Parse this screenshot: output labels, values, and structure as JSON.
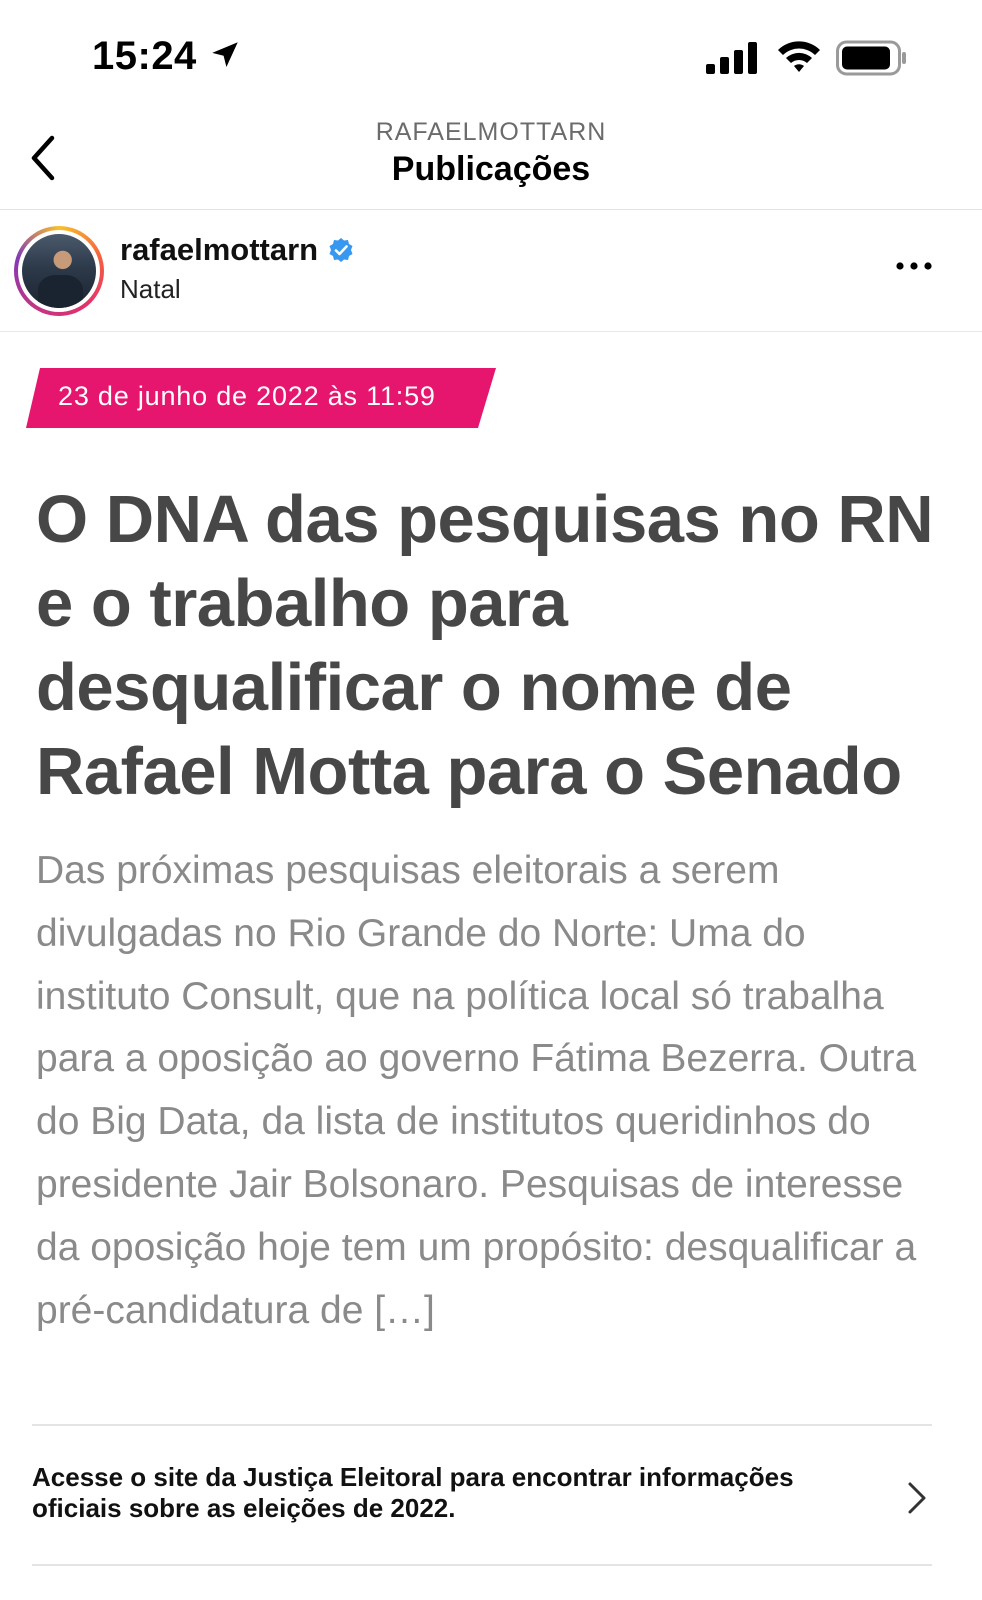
{
  "status_bar": {
    "time": "15:24",
    "icons": [
      "location-arrow-icon",
      "cellular-signal-icon",
      "wifi-icon",
      "battery-icon"
    ]
  },
  "header": {
    "account_caps": "RAFAELMOTTARN",
    "title": "Publicações",
    "back_icon": "chevron-left-icon"
  },
  "post": {
    "username": "rafaelmottarn",
    "verified": true,
    "location": "Natal",
    "more_icon": "ellipsis-icon",
    "date_tag": "23 de junho de 2022 às 11:59",
    "headline": "O DNA das pesquisas no RN e o trabalho para desqualificar o nome de Rafael Motta para o Senado",
    "excerpt": "Das próximas pesquisas eleitorais a serem divulgadas no Rio Grande do Norte: Uma do instituto Consult, que na política local só trabalha para a oposição ao governo Fátima Bezerra. Outra do Big Data, da lista de institutos queridinhos do presidente Jair Bolsonaro. Pesquisas de interesse da oposição hoje tem um propósito: desqualificar a pré-candidatura de […]"
  },
  "election_banner": {
    "text": "Acesse o site da Justiça Eleitoral para encontrar informações oficiais sobre as eleições de 2022."
  },
  "colors": {
    "tag_pink": "#e6166f",
    "headline_gray": "#474747",
    "excerpt_gray": "#8a8a8a",
    "verified_blue": "#3897f0"
  }
}
